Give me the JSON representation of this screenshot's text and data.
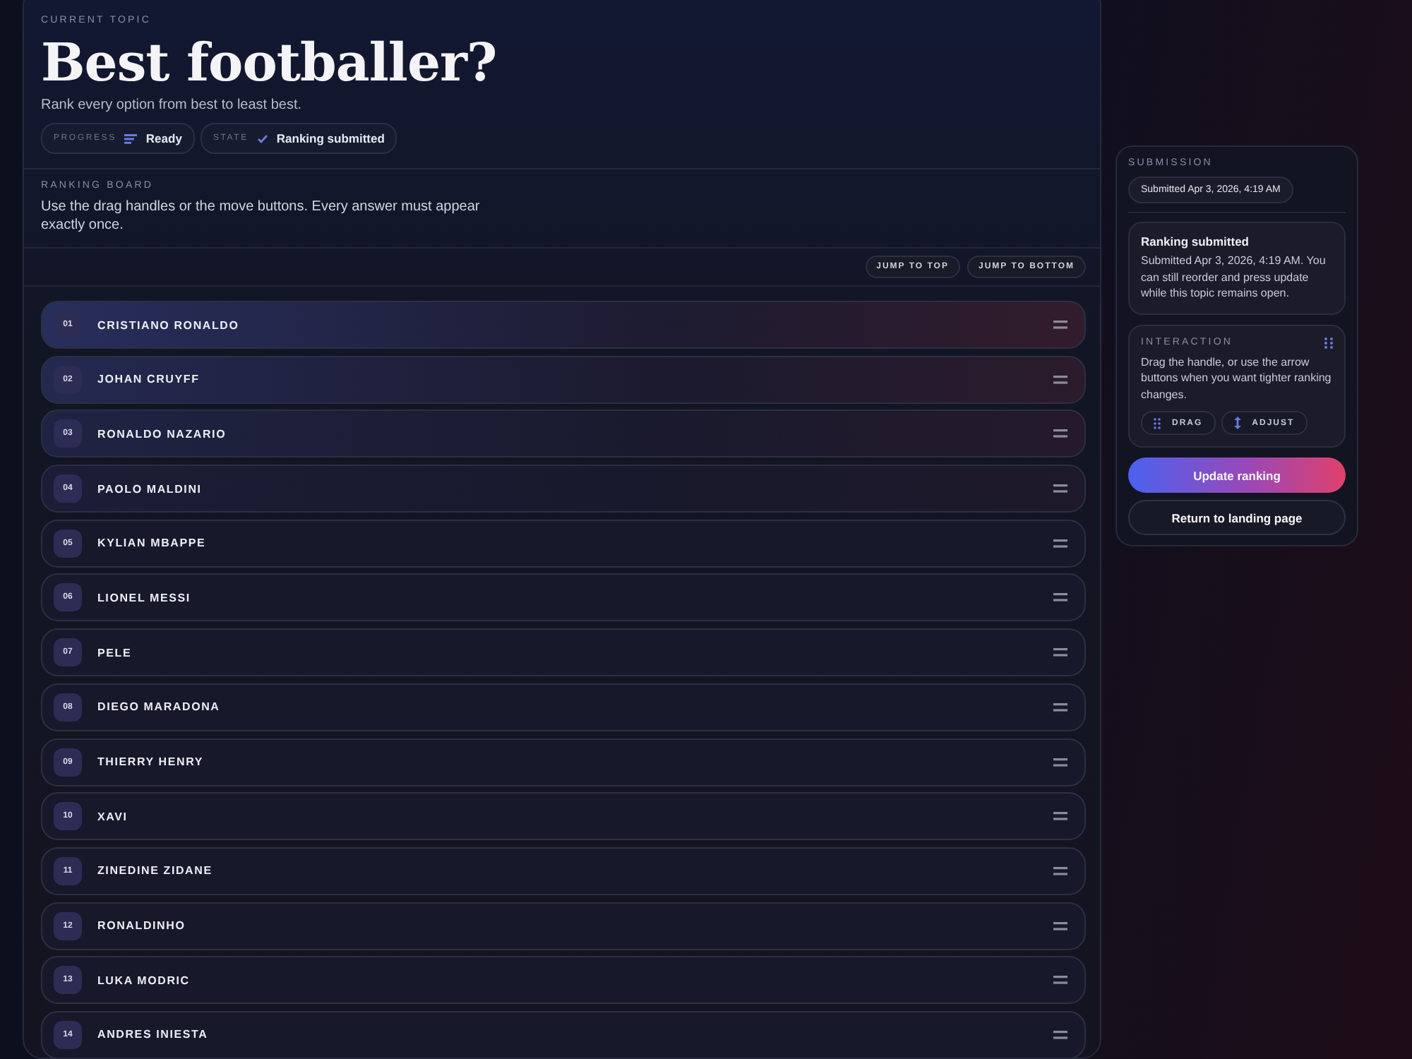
{
  "topic": {
    "eyebrow": "CURRENT TOPIC",
    "title": "Best footballer?",
    "subtitle": "Rank every option from best to least best.",
    "chips": [
      {
        "label": "PROGRESS",
        "kind": "progress",
        "value": "Ready"
      },
      {
        "label": "STATE",
        "kind": "check",
        "value": "Ranking submitted"
      }
    ]
  },
  "board": {
    "eyebrow": "RANKING BOARD",
    "description": "Use the drag handles or the move buttons. Every answer must appear exactly once.",
    "buttons": [
      "JUMP TO TOP",
      "JUMP TO BOTTOM"
    ],
    "items": [
      {
        "rank": "01",
        "name": "CRISTIANO RONALDO"
      },
      {
        "rank": "02",
        "name": "JOHAN CRUYFF"
      },
      {
        "rank": "03",
        "name": "RONALDO NAZARIO"
      },
      {
        "rank": "04",
        "name": "PAOLO MALDINI"
      },
      {
        "rank": "05",
        "name": "KYLIAN MBAPPE"
      },
      {
        "rank": "06",
        "name": "LIONEL MESSI"
      },
      {
        "rank": "07",
        "name": "PELE"
      },
      {
        "rank": "08",
        "name": "DIEGO MARADONA"
      },
      {
        "rank": "09",
        "name": "THIERRY HENRY"
      },
      {
        "rank": "10",
        "name": "XAVI"
      },
      {
        "rank": "11",
        "name": "ZINEDINE ZIDANE"
      },
      {
        "rank": "12",
        "name": "RONALDINHO"
      },
      {
        "rank": "13",
        "name": "LUKA MODRIC"
      },
      {
        "rank": "14",
        "name": "ANDRES INIESTA"
      }
    ]
  },
  "submission": {
    "eyebrow": "SUBMISSION",
    "timestamp": "Submitted Apr 3, 2026, 4:19 AM",
    "notice": {
      "title": "Ranking submitted",
      "text": "Submitted Apr 3, 2026, 4:19 AM. You can still reorder and press update while this topic remains open."
    },
    "interaction": {
      "eyebrow": "INTERACTION",
      "text": "Drag the handle, or use the arrow buttons when you want tighter ranking changes.",
      "chips": [
        {
          "kind": "drag",
          "label": "DRAG"
        },
        {
          "kind": "adjust",
          "label": "ADJUST"
        }
      ]
    },
    "primary": "Update ranking",
    "secondary": "Return to landing page"
  }
}
